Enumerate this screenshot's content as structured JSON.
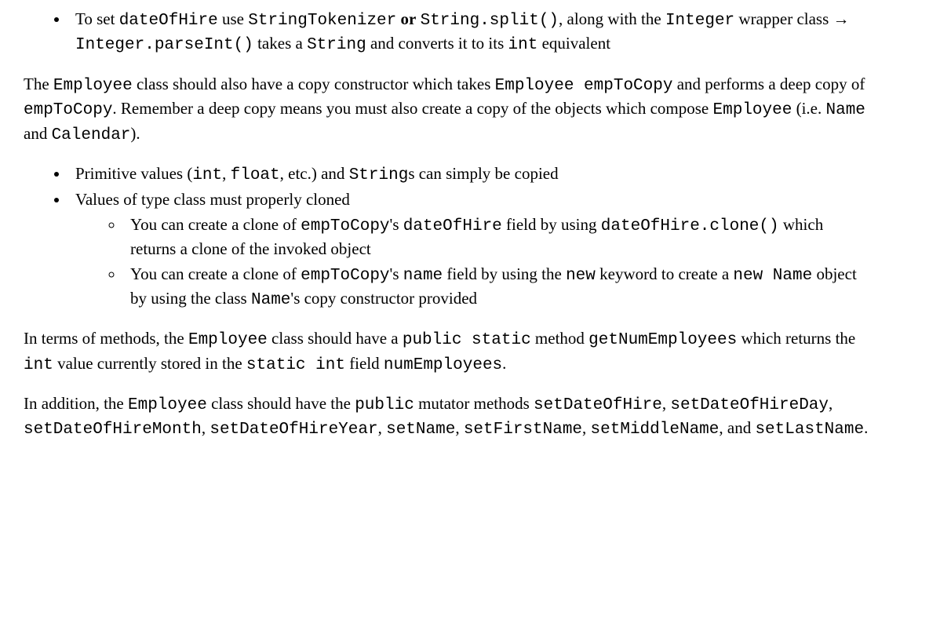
{
  "b1": {
    "t1": "To set ",
    "c1": "dateOfHire",
    "t2": " use ",
    "c2": "StringTokenizer",
    "t3": " ",
    "or": "or",
    "t3b": " ",
    "c3": "String.split()",
    "t4": ", along with the ",
    "c4": "Integer",
    "t5": " wrapper class ",
    "arrow": "→",
    "t5b": " ",
    "c5": "Integer.parseInt()",
    "t6": " takes a ",
    "c6": "String",
    "t7": " and converts it to its ",
    "c7": "int",
    "t8": " equivalent"
  },
  "p1": {
    "t1": "The ",
    "c1": "Employee",
    "t2": " class should also have a copy constructor which takes ",
    "c2": "Employee empToCopy",
    "t3": " and performs a deep copy of ",
    "c3": "empToCopy",
    "t4": ". Remember a deep copy means you must also create a copy of the objects which compose ",
    "c4": "Employee",
    "t5": " (i.e. ",
    "c5": "Name",
    "t6": " and ",
    "c6": "Calendar",
    "t7": ")."
  },
  "b2a": {
    "t1": "Primitive values (",
    "c1": "int",
    "t2": ", ",
    "c2": "float",
    "t3": ", etc.) and ",
    "c3": "String",
    "t4": "s can simply be copied"
  },
  "b2b": {
    "t1": "Values of type class must properly cloned"
  },
  "b2b1": {
    "t1": "You can create a clone of ",
    "c1": "empToCopy",
    "t2": "'s ",
    "c2": "dateOfHire",
    "t3": " field by using ",
    "c3": "dateOfHire.clone()",
    "t4": " which returns a clone of the invoked object"
  },
  "b2b2": {
    "t1": "You can create a clone of ",
    "c1": "empToCopy",
    "t2": "'s ",
    "c2": "name",
    "t3": " field by using the ",
    "c3": "new",
    "t4": " keyword to create a ",
    "c4": "new Name",
    "t5": " object by using the class ",
    "c5": "Name",
    "t6": "'s copy constructor provided"
  },
  "p2": {
    "t1": "In terms of methods, the ",
    "c1": "Employee",
    "t2": " class should have a ",
    "c2": "public static",
    "t3": " method ",
    "c3": "getNumEmployees",
    "t4": " which returns the ",
    "c4": "int",
    "t5": " value currently stored in the ",
    "c5": "static int",
    "t6": " field ",
    "c6": "numEmployees",
    "t7": "."
  },
  "p3": {
    "t1": "In addition, the ",
    "c1": "Employee",
    "t2": " class should have the ",
    "c2": "public",
    "t3": " mutator methods ",
    "c3": "setDateOfHire",
    "t4": ", ",
    "c4": "setDateOfHireDay",
    "t5": ", ",
    "c5": "setDateOfHireMonth",
    "t6": ", ",
    "c6": "setDateOfHireYear",
    "t7": ", ",
    "c7": "setName",
    "t8": ", ",
    "c8": "setFirstName",
    "t9": ", ",
    "c9": "setMiddleName",
    "t10": ", and ",
    "c10": "setLastName",
    "t11": "."
  }
}
